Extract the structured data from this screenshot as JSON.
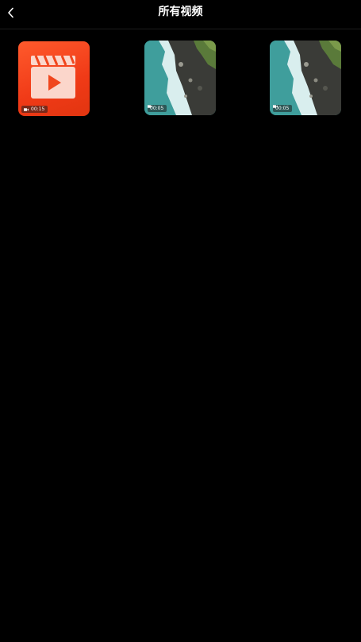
{
  "header": {
    "title": "所有视频",
    "back_icon": "chevron-left-icon"
  },
  "videos": [
    {
      "thumbnail": "video-app-icon",
      "duration": "00:15"
    },
    {
      "thumbnail": "coastline-aerial",
      "duration": "00:05"
    },
    {
      "thumbnail": "coastline-aerial",
      "duration": "00:05"
    }
  ],
  "colors": {
    "background": "#000000",
    "app_icon_orange": "#f2431b",
    "text": "#ffffff"
  }
}
